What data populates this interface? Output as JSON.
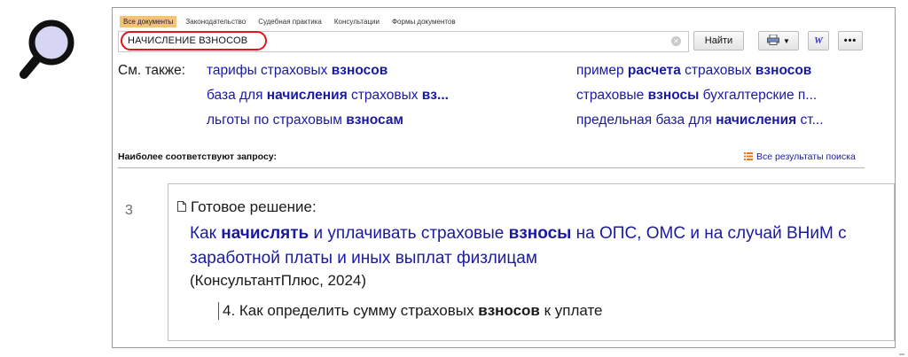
{
  "search": {
    "tabs": [
      {
        "label": "Все документы",
        "active": true
      },
      {
        "label": "Законодательство",
        "active": false
      },
      {
        "label": "Судебная практика",
        "active": false
      },
      {
        "label": "Консультации",
        "active": false
      },
      {
        "label": "Формы документов",
        "active": false
      }
    ],
    "query": "НАЧИСЛЕНИЕ ВЗНОСОВ",
    "find_label": "Найти",
    "word_label": "W",
    "more_label": "•••"
  },
  "see_also": {
    "label": "См. также:",
    "links": [
      {
        "plain1": "тарифы страховых ",
        "bold1": "взносов",
        "plain2": "",
        "bold2": "",
        "plain3": ""
      },
      {
        "plain1": "база для ",
        "bold1": "начисления",
        "plain2": " страховых ",
        "bold2": "вз...",
        "plain3": ""
      },
      {
        "plain1": "льготы по страховым ",
        "bold1": "взносам",
        "plain2": "",
        "bold2": "",
        "plain3": ""
      },
      {
        "plain1": "пример ",
        "bold1": "расчета",
        "plain2": " страховых ",
        "bold2": "взносов",
        "plain3": ""
      },
      {
        "plain1": "страховые ",
        "bold1": "взносы",
        "plain2": " бухгалтерские п...",
        "bold2": "",
        "plain3": ""
      },
      {
        "plain1": "предельная база для ",
        "bold1": "начисления",
        "plain2": " ст...",
        "bold2": "",
        "plain3": ""
      }
    ]
  },
  "results": {
    "section_title": "Наиболее соответствуют запросу:",
    "all_results_label": "Все результаты поиска",
    "item": {
      "number": "3",
      "type": "Готовое решение:",
      "title_parts": [
        "Как ",
        "начислять",
        " и уплачивать страховые ",
        "взносы",
        " на ОПС, ОМС и на случай ВНиМ с заработной платы и иных выплат физлицам"
      ],
      "source": "(КонсультантПлюс, 2024)",
      "sub_parts": [
        "4. Как определить сумму страховых ",
        "взносов",
        " к уплате"
      ]
    }
  },
  "colors": {
    "link": "#1a1aa0",
    "active_tab": "#f5c27a",
    "highlight_oval": "#e4141b"
  },
  "icons": {
    "magnifier": "search-icon",
    "clear": "clear-icon",
    "print": "printer-icon",
    "word": "word-export-icon",
    "more": "more-icon",
    "doc": "document-icon",
    "all_results": "list-icon"
  }
}
